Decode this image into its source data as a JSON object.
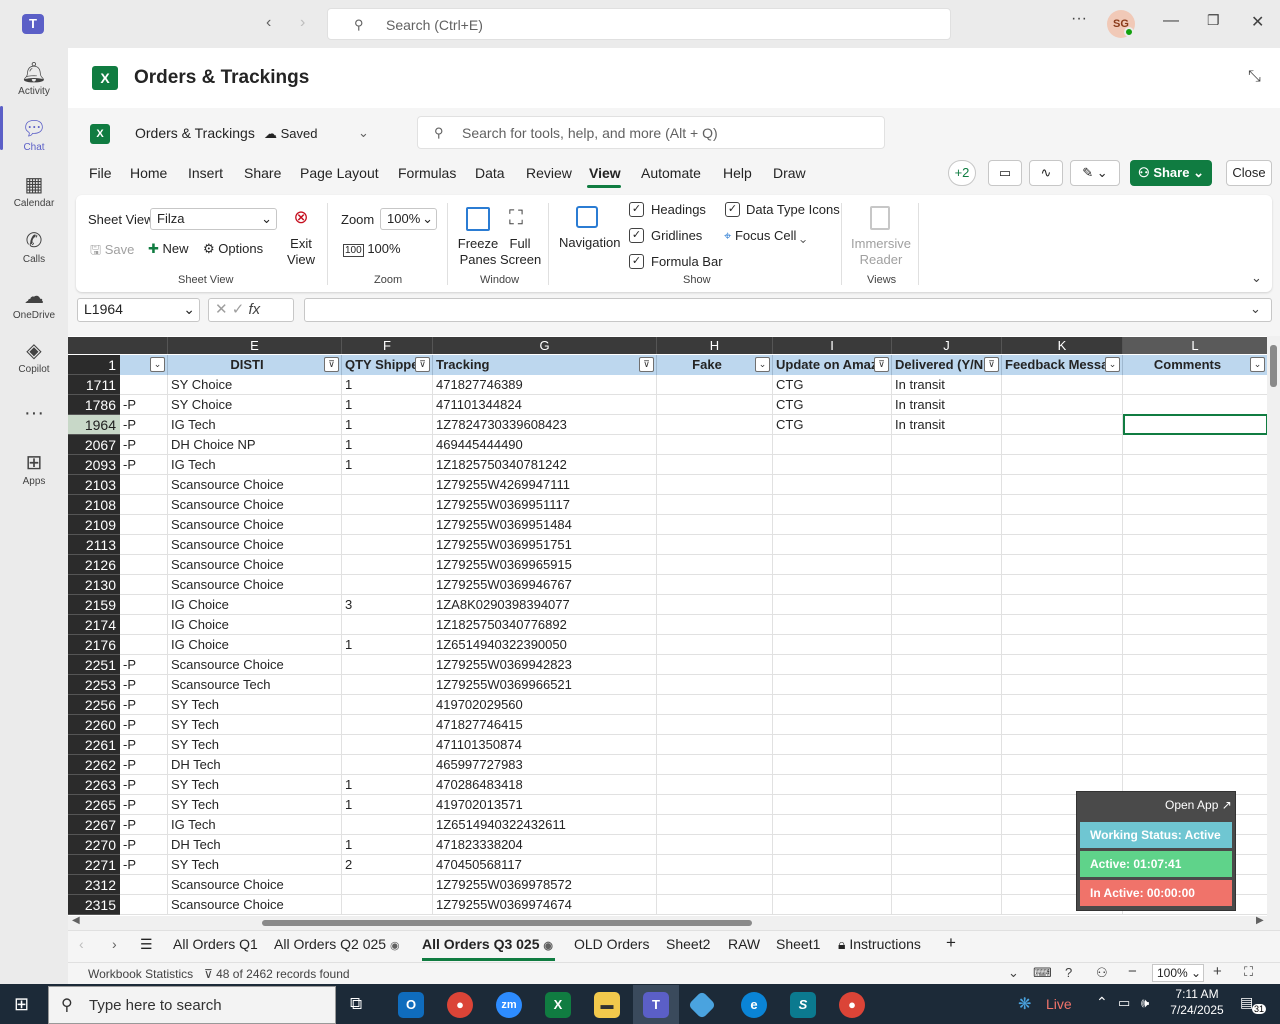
{
  "teams": {
    "search_placeholder": "Search (Ctrl+E)",
    "avatar_initials": "SG",
    "rail": [
      {
        "label": "Activity",
        "icon": "bell-icon"
      },
      {
        "label": "Chat",
        "icon": "chat-icon"
      },
      {
        "label": "Calendar",
        "icon": "calendar-icon"
      },
      {
        "label": "Calls",
        "icon": "phone-icon"
      },
      {
        "label": "OneDrive",
        "icon": "cloud-icon"
      },
      {
        "label": "Copilot",
        "icon": "copilot-icon"
      },
      {
        "label": "",
        "icon": "more-icon"
      },
      {
        "label": "Apps",
        "icon": "add-apps-icon"
      }
    ]
  },
  "app": {
    "title": "Orders & Trackings"
  },
  "excel": {
    "workbook_name": "Orders & Trackings",
    "saved_label": "Saved",
    "search_placeholder": "Search for tools, help, and more (Alt + Q)",
    "menus": [
      "File",
      "Home",
      "Insert",
      "Share",
      "Page Layout",
      "Formulas",
      "Data",
      "Review",
      "View",
      "Automate",
      "Help",
      "Draw"
    ],
    "active_menu": "View",
    "collab_count": "+2",
    "share_label": "Share",
    "close_label": "Close",
    "ribbon": {
      "sheet_view_label": "Sheet View",
      "sheet_view_value": "Filza",
      "save": "Save",
      "new": "New",
      "options": "Options",
      "exit_view": "Exit View",
      "group_sheet_view": "Sheet View",
      "zoom_label": "Zoom",
      "zoom_value": "100%",
      "zoom_100": "100%",
      "group_zoom": "Zoom",
      "freeze_panes": "Freeze Panes",
      "full_screen": "Full Screen",
      "group_window": "Window",
      "navigation": "Navigation",
      "headings": "Headings",
      "gridlines": "Gridlines",
      "formula_bar": "Formula Bar",
      "data_type_icons": "Data Type Icons",
      "focus_cell": "Focus Cell",
      "group_show": "Show",
      "immersive_reader": "Immersive Reader",
      "group_views": "Views"
    },
    "name_box": "L1964",
    "fx": "fx",
    "columns": [
      "E",
      "F",
      "G",
      "H",
      "I",
      "J",
      "K",
      "L"
    ],
    "header_row_number": "1",
    "headers": [
      "DISTI",
      "QTY Shipped",
      "Tracking",
      "Fake",
      "Update on Amaz",
      "Delivered (Y/N",
      "Feedback Messa",
      "Comments"
    ],
    "rows": [
      {
        "n": "1711",
        "d": "",
        "e": "SY Choice",
        "f": "1",
        "g": "471827746389",
        "i": "CTG",
        "j": "In transit"
      },
      {
        "n": "1786",
        "d": "-P",
        "e": "SY Choice",
        "f": "1",
        "g": "471101344824",
        "i": "CTG",
        "j": "In transit"
      },
      {
        "n": "1964",
        "d": "-P",
        "e": "IG Tech",
        "f": "1",
        "g": "1Z7824730339608423",
        "i": "CTG",
        "j": "In transit"
      },
      {
        "n": "2067",
        "d": "-P",
        "e": "DH Choice NP",
        "f": "1",
        "g": "469445444490",
        "i": "",
        "j": ""
      },
      {
        "n": "2093",
        "d": "-P",
        "e": "IG Tech",
        "f": "1",
        "g": "1Z1825750340781242",
        "i": "",
        "j": ""
      },
      {
        "n": "2103",
        "d": "",
        "e": "Scansource Choice",
        "f": "",
        "g": "1Z79255W4269947111",
        "i": "",
        "j": ""
      },
      {
        "n": "2108",
        "d": "",
        "e": "Scansource Choice",
        "f": "",
        "g": "1Z79255W0369951117",
        "i": "",
        "j": ""
      },
      {
        "n": "2109",
        "d": "",
        "e": "Scansource Choice",
        "f": "",
        "g": "1Z79255W0369951484",
        "i": "",
        "j": ""
      },
      {
        "n": "2113",
        "d": "",
        "e": "Scansource Choice",
        "f": "",
        "g": "1Z79255W0369951751",
        "i": "",
        "j": ""
      },
      {
        "n": "2126",
        "d": "",
        "e": "Scansource Choice",
        "f": "",
        "g": "1Z79255W0369965915",
        "i": "",
        "j": ""
      },
      {
        "n": "2130",
        "d": "",
        "e": "Scansource Choice",
        "f": "",
        "g": "1Z79255W0369946767",
        "i": "",
        "j": ""
      },
      {
        "n": "2159",
        "d": "",
        "e": "IG Choice",
        "f": "3",
        "g": "1ZA8K0290398394077",
        "i": "",
        "j": ""
      },
      {
        "n": "2174",
        "d": "",
        "e": "IG Choice",
        "f": "",
        "g": "1Z1825750340776892",
        "i": "",
        "j": ""
      },
      {
        "n": "2176",
        "d": "",
        "e": "IG Choice",
        "f": "1",
        "g": "1Z6514940322390050",
        "i": "",
        "j": ""
      },
      {
        "n": "2251",
        "d": "-P",
        "e": "Scansource Choice",
        "f": "",
        "g": "1Z79255W0369942823",
        "i": "",
        "j": ""
      },
      {
        "n": "2253",
        "d": "-P",
        "e": "Scansource Tech",
        "f": "",
        "g": "1Z79255W0369966521",
        "i": "",
        "j": ""
      },
      {
        "n": "2256",
        "d": "-P",
        "e": "SY Tech",
        "f": "",
        "g": "419702029560",
        "i": "",
        "j": ""
      },
      {
        "n": "2260",
        "d": "-P",
        "e": "SY Tech",
        "f": "",
        "g": "471827746415",
        "i": "",
        "j": ""
      },
      {
        "n": "2261",
        "d": "-P",
        "e": "SY Tech",
        "f": "",
        "g": "471101350874",
        "i": "",
        "j": ""
      },
      {
        "n": "2262",
        "d": "-P",
        "e": "DH Tech",
        "f": "",
        "g": "465997727983",
        "i": "",
        "j": ""
      },
      {
        "n": "2263",
        "d": "-P",
        "e": "SY Tech",
        "f": "1",
        "g": "470286483418",
        "i": "",
        "j": ""
      },
      {
        "n": "2265",
        "d": "-P",
        "e": "SY Tech",
        "f": "1",
        "g": "419702013571",
        "i": "",
        "j": ""
      },
      {
        "n": "2267",
        "d": "-P",
        "e": "IG Tech",
        "f": "",
        "g": "1Z6514940322432611",
        "i": "",
        "j": ""
      },
      {
        "n": "2270",
        "d": "-P",
        "e": "DH Tech",
        "f": "1",
        "g": "471823338204",
        "i": "",
        "j": ""
      },
      {
        "n": "2271",
        "d": "-P",
        "e": "SY Tech",
        "f": "2",
        "g": "470450568117",
        "i": "",
        "j": ""
      },
      {
        "n": "2312",
        "d": "",
        "e": "Scansource Choice",
        "f": "",
        "g": "1Z79255W0369978572",
        "i": "",
        "j": ""
      },
      {
        "n": "2315",
        "d": "",
        "e": "Scansource Choice",
        "f": "",
        "g": "1Z79255W0369974674",
        "i": "",
        "j": ""
      }
    ],
    "sheet_tabs": [
      "All Orders Q1",
      "All Orders Q2 025",
      "All Orders Q3 025",
      "OLD Orders",
      "Sheet2",
      "RAW",
      "Sheet1",
      "Instructions"
    ],
    "active_tab": "All Orders Q3 025",
    "status_left": "Workbook Statistics",
    "records_found": "48 of 2462 records found",
    "zoom_status": "100%"
  },
  "widget": {
    "open_app": "Open App",
    "working_status": "Working Status: Active",
    "active_time": "Active: 01:07:41",
    "inactive_time": "In Active: 00:00:00",
    "colors": {
      "working": "#6fc6d2",
      "active": "#5fd38a",
      "inactive": "#f0736a"
    }
  },
  "taskbar": {
    "search_placeholder": "Type here to search",
    "weather_label": "Live",
    "time": "7:11 AM",
    "date": "7/24/2025",
    "notifications": "31"
  }
}
